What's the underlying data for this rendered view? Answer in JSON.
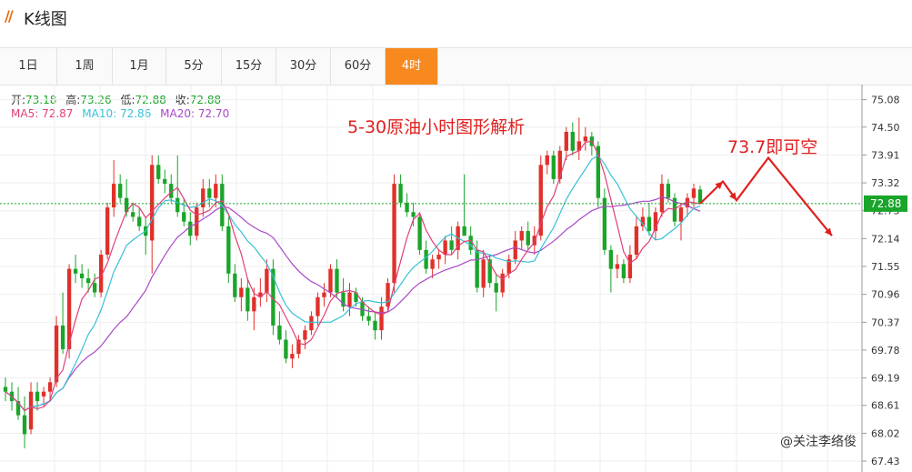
{
  "header": {
    "logo": "//",
    "title": "K线图"
  },
  "tabs": [
    "1日",
    "1周",
    "1月",
    "5分",
    "15分",
    "30分",
    "60分",
    "4时"
  ],
  "active_tab": 7,
  "colors": {
    "up": "#e0302a",
    "down": "#1aa52a",
    "ma5": "#e0407a",
    "ma10": "#38c0d8",
    "ma20": "#a848c8",
    "accent": "#f7891e",
    "annotation": "#e02020",
    "price_line": "#1aa52a"
  },
  "legend": {
    "open_label": "开:",
    "open": "73.18",
    "high_label": "高:",
    "high": "73.26",
    "low_label": "低:",
    "low": "72.88",
    "close_label": "收:",
    "close": "72.88",
    "ma5_label": "MA5:",
    "ma5": "72.87",
    "ma10_label": "MA10:",
    "ma10": "72.86",
    "ma20_label": "MA20:",
    "ma20": "72.70"
  },
  "annotations": {
    "headline": "5-30原油小时图形解析",
    "target": "73.7即可空"
  },
  "watermark": "@关注李络俊",
  "chart_data": {
    "type": "candlestick",
    "ylim": [
      67.2,
      75.4
    ],
    "yticks": [
      "75.08",
      "74.50",
      "73.91",
      "73.32",
      "72.73",
      "72.14",
      "71.55",
      "70.96",
      "70.37",
      "69.78",
      "69.19",
      "68.61",
      "68.02",
      "67.43"
    ],
    "current_price": "72.88",
    "candles": [
      {
        "o": 69.0,
        "h": 69.2,
        "l": 68.7,
        "c": 68.9
      },
      {
        "o": 68.9,
        "h": 69.1,
        "l": 68.5,
        "c": 68.7
      },
      {
        "o": 68.7,
        "h": 69.0,
        "l": 68.3,
        "c": 68.4
      },
      {
        "o": 68.4,
        "h": 68.8,
        "l": 67.7,
        "c": 68.0
      },
      {
        "o": 68.1,
        "h": 69.1,
        "l": 68.0,
        "c": 68.9
      },
      {
        "o": 68.9,
        "h": 69.1,
        "l": 68.5,
        "c": 68.7
      },
      {
        "o": 68.8,
        "h": 69.0,
        "l": 68.6,
        "c": 68.9
      },
      {
        "o": 68.9,
        "h": 69.2,
        "l": 68.7,
        "c": 69.1
      },
      {
        "o": 69.1,
        "h": 70.5,
        "l": 69.0,
        "c": 70.3
      },
      {
        "o": 70.3,
        "h": 71.0,
        "l": 69.7,
        "c": 69.8
      },
      {
        "o": 69.8,
        "h": 71.6,
        "l": 69.6,
        "c": 71.5
      },
      {
        "o": 71.5,
        "h": 71.8,
        "l": 71.2,
        "c": 71.4
      },
      {
        "o": 71.4,
        "h": 71.6,
        "l": 71.1,
        "c": 71.3
      },
      {
        "o": 71.3,
        "h": 71.5,
        "l": 71.0,
        "c": 71.2
      },
      {
        "o": 71.2,
        "h": 71.4,
        "l": 70.9,
        "c": 71.0
      },
      {
        "o": 71.0,
        "h": 71.9,
        "l": 70.9,
        "c": 71.8
      },
      {
        "o": 71.8,
        "h": 72.9,
        "l": 71.7,
        "c": 72.8
      },
      {
        "o": 72.8,
        "h": 73.8,
        "l": 72.6,
        "c": 73.3
      },
      {
        "o": 73.3,
        "h": 73.5,
        "l": 72.9,
        "c": 73.0
      },
      {
        "o": 73.0,
        "h": 73.4,
        "l": 72.6,
        "c": 72.7
      },
      {
        "o": 72.7,
        "h": 72.9,
        "l": 72.5,
        "c": 72.6
      },
      {
        "o": 72.6,
        "h": 72.8,
        "l": 72.3,
        "c": 72.4
      },
      {
        "o": 72.4,
        "h": 72.6,
        "l": 71.8,
        "c": 72.2
      },
      {
        "o": 72.1,
        "h": 73.9,
        "l": 71.4,
        "c": 73.7
      },
      {
        "o": 73.7,
        "h": 73.9,
        "l": 73.3,
        "c": 73.4
      },
      {
        "o": 73.4,
        "h": 73.6,
        "l": 73.1,
        "c": 73.3
      },
      {
        "o": 73.3,
        "h": 73.5,
        "l": 72.9,
        "c": 73.0
      },
      {
        "o": 73.0,
        "h": 73.9,
        "l": 72.6,
        "c": 72.7
      },
      {
        "o": 72.7,
        "h": 73.0,
        "l": 72.4,
        "c": 72.5
      },
      {
        "o": 72.5,
        "h": 72.7,
        "l": 72.0,
        "c": 72.2
      },
      {
        "o": 72.2,
        "h": 72.9,
        "l": 72.1,
        "c": 72.8
      },
      {
        "o": 72.8,
        "h": 73.4,
        "l": 72.6,
        "c": 73.2
      },
      {
        "o": 73.2,
        "h": 73.4,
        "l": 72.8,
        "c": 73.0
      },
      {
        "o": 73.0,
        "h": 73.5,
        "l": 72.8,
        "c": 73.3
      },
      {
        "o": 73.3,
        "h": 73.5,
        "l": 72.3,
        "c": 72.4
      },
      {
        "o": 72.4,
        "h": 72.6,
        "l": 71.2,
        "c": 71.4
      },
      {
        "o": 71.4,
        "h": 71.6,
        "l": 70.8,
        "c": 70.9
      },
      {
        "o": 70.9,
        "h": 71.3,
        "l": 70.6,
        "c": 71.1
      },
      {
        "o": 71.1,
        "h": 71.3,
        "l": 70.4,
        "c": 70.6
      },
      {
        "o": 70.6,
        "h": 71.1,
        "l": 70.2,
        "c": 70.9
      },
      {
        "o": 70.9,
        "h": 71.3,
        "l": 70.7,
        "c": 71.0
      },
      {
        "o": 71.0,
        "h": 71.7,
        "l": 70.8,
        "c": 71.5
      },
      {
        "o": 71.5,
        "h": 71.7,
        "l": 70.1,
        "c": 70.3
      },
      {
        "o": 70.3,
        "h": 70.6,
        "l": 69.9,
        "c": 70.0
      },
      {
        "o": 70.0,
        "h": 70.2,
        "l": 69.5,
        "c": 69.6
      },
      {
        "o": 69.6,
        "h": 69.9,
        "l": 69.4,
        "c": 69.7
      },
      {
        "o": 69.7,
        "h": 70.1,
        "l": 69.6,
        "c": 70.0
      },
      {
        "o": 70.0,
        "h": 70.3,
        "l": 69.8,
        "c": 70.2
      },
      {
        "o": 70.2,
        "h": 70.6,
        "l": 70.1,
        "c": 70.5
      },
      {
        "o": 70.5,
        "h": 71.0,
        "l": 70.3,
        "c": 70.9
      },
      {
        "o": 70.9,
        "h": 71.2,
        "l": 70.7,
        "c": 71.0
      },
      {
        "o": 71.0,
        "h": 71.6,
        "l": 70.9,
        "c": 71.5
      },
      {
        "o": 71.5,
        "h": 71.7,
        "l": 70.9,
        "c": 71.0
      },
      {
        "o": 71.0,
        "h": 71.3,
        "l": 70.6,
        "c": 70.7
      },
      {
        "o": 70.7,
        "h": 71.2,
        "l": 70.5,
        "c": 71.0
      },
      {
        "o": 71.0,
        "h": 71.1,
        "l": 70.7,
        "c": 70.8
      },
      {
        "o": 70.8,
        "h": 70.9,
        "l": 70.4,
        "c": 70.5
      },
      {
        "o": 70.5,
        "h": 70.7,
        "l": 70.3,
        "c": 70.4
      },
      {
        "o": 70.4,
        "h": 70.6,
        "l": 70.0,
        "c": 70.2
      },
      {
        "o": 70.2,
        "h": 70.9,
        "l": 70.0,
        "c": 70.7
      },
      {
        "o": 70.7,
        "h": 71.3,
        "l": 70.6,
        "c": 71.2
      },
      {
        "o": 71.2,
        "h": 73.5,
        "l": 71.0,
        "c": 73.3
      },
      {
        "o": 73.3,
        "h": 73.5,
        "l": 72.8,
        "c": 72.9
      },
      {
        "o": 72.9,
        "h": 73.1,
        "l": 72.6,
        "c": 72.7
      },
      {
        "o": 72.7,
        "h": 72.9,
        "l": 72.4,
        "c": 72.6
      },
      {
        "o": 72.6,
        "h": 72.7,
        "l": 71.8,
        "c": 71.9
      },
      {
        "o": 71.9,
        "h": 72.1,
        "l": 71.4,
        "c": 71.5
      },
      {
        "o": 71.5,
        "h": 71.8,
        "l": 71.3,
        "c": 71.7
      },
      {
        "o": 71.7,
        "h": 71.9,
        "l": 71.5,
        "c": 71.8
      },
      {
        "o": 71.8,
        "h": 72.2,
        "l": 71.6,
        "c": 72.1
      },
      {
        "o": 72.1,
        "h": 72.4,
        "l": 71.8,
        "c": 71.9
      },
      {
        "o": 71.9,
        "h": 72.5,
        "l": 71.7,
        "c": 72.4
      },
      {
        "o": 72.4,
        "h": 73.5,
        "l": 72.2,
        "c": 72.2
      },
      {
        "o": 72.2,
        "h": 72.4,
        "l": 71.8,
        "c": 71.9
      },
      {
        "o": 71.9,
        "h": 72.1,
        "l": 71.0,
        "c": 71.1
      },
      {
        "o": 71.1,
        "h": 71.9,
        "l": 70.9,
        "c": 71.7
      },
      {
        "o": 71.7,
        "h": 71.8,
        "l": 71.1,
        "c": 71.2
      },
      {
        "o": 71.2,
        "h": 71.4,
        "l": 70.6,
        "c": 71.0
      },
      {
        "o": 71.0,
        "h": 71.5,
        "l": 70.9,
        "c": 71.4
      },
      {
        "o": 71.4,
        "h": 71.8,
        "l": 71.3,
        "c": 71.7
      },
      {
        "o": 71.7,
        "h": 72.3,
        "l": 71.6,
        "c": 72.1
      },
      {
        "o": 72.1,
        "h": 72.4,
        "l": 71.9,
        "c": 72.3
      },
      {
        "o": 72.3,
        "h": 72.5,
        "l": 71.9,
        "c": 72.0
      },
      {
        "o": 72.0,
        "h": 72.4,
        "l": 71.8,
        "c": 72.2
      },
      {
        "o": 72.2,
        "h": 73.9,
        "l": 72.1,
        "c": 73.7
      },
      {
        "o": 73.7,
        "h": 74.0,
        "l": 73.5,
        "c": 73.9
      },
      {
        "o": 73.9,
        "h": 74.0,
        "l": 73.3,
        "c": 73.4
      },
      {
        "o": 73.4,
        "h": 74.1,
        "l": 73.3,
        "c": 74.0
      },
      {
        "o": 74.0,
        "h": 74.5,
        "l": 73.8,
        "c": 74.4
      },
      {
        "o": 74.4,
        "h": 74.6,
        "l": 73.9,
        "c": 74.0
      },
      {
        "o": 74.0,
        "h": 74.7,
        "l": 73.8,
        "c": 74.2
      },
      {
        "o": 74.2,
        "h": 74.5,
        "l": 74.0,
        "c": 74.3
      },
      {
        "o": 74.3,
        "h": 74.4,
        "l": 73.9,
        "c": 74.1
      },
      {
        "o": 74.1,
        "h": 74.2,
        "l": 72.8,
        "c": 73.0
      },
      {
        "o": 73.0,
        "h": 73.2,
        "l": 71.8,
        "c": 71.9
      },
      {
        "o": 71.9,
        "h": 72.0,
        "l": 71.0,
        "c": 71.5
      },
      {
        "o": 71.5,
        "h": 71.8,
        "l": 71.3,
        "c": 71.6
      },
      {
        "o": 71.6,
        "h": 71.7,
        "l": 71.2,
        "c": 71.3
      },
      {
        "o": 71.3,
        "h": 72.0,
        "l": 71.2,
        "c": 71.8
      },
      {
        "o": 71.8,
        "h": 72.6,
        "l": 71.7,
        "c": 72.4
      },
      {
        "o": 72.4,
        "h": 72.8,
        "l": 72.3,
        "c": 72.6
      },
      {
        "o": 72.6,
        "h": 72.9,
        "l": 72.2,
        "c": 72.3
      },
      {
        "o": 72.3,
        "h": 72.8,
        "l": 72.1,
        "c": 72.7
      },
      {
        "o": 72.7,
        "h": 73.5,
        "l": 72.6,
        "c": 73.3
      },
      {
        "o": 73.3,
        "h": 73.4,
        "l": 72.9,
        "c": 73.0
      },
      {
        "o": 73.0,
        "h": 73.1,
        "l": 72.4,
        "c": 72.5
      },
      {
        "o": 72.5,
        "h": 72.9,
        "l": 72.1,
        "c": 72.8
      },
      {
        "o": 72.8,
        "h": 73.1,
        "l": 72.6,
        "c": 73.0
      },
      {
        "o": 73.0,
        "h": 73.3,
        "l": 72.8,
        "c": 73.2
      },
      {
        "o": 73.18,
        "h": 73.26,
        "l": 72.88,
        "c": 72.88
      }
    ],
    "projection": [
      72.88,
      73.35,
      72.95,
      73.85,
      72.2
    ]
  }
}
